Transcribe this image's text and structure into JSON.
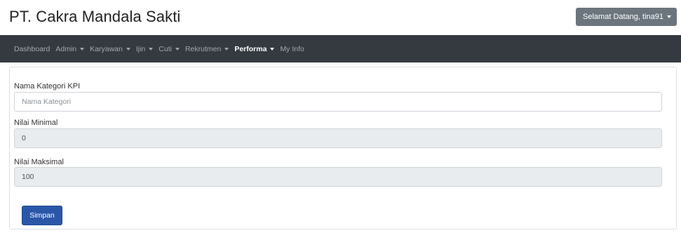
{
  "header": {
    "brand": "PT. Cakra Mandala Sakti",
    "user_menu_label": "Selamat Datang, tina91"
  },
  "nav": {
    "items": [
      {
        "label": "Dashboard",
        "dropdown": false,
        "active": false
      },
      {
        "label": "Admin",
        "dropdown": true,
        "active": false
      },
      {
        "label": "Karyawan",
        "dropdown": true,
        "active": false
      },
      {
        "label": "Ijin",
        "dropdown": true,
        "active": false
      },
      {
        "label": "Cuti",
        "dropdown": true,
        "active": false
      },
      {
        "label": "Rekrutmen",
        "dropdown": true,
        "active": false
      },
      {
        "label": "Performa",
        "dropdown": true,
        "active": true
      },
      {
        "label": "My Info",
        "dropdown": false,
        "active": false
      }
    ]
  },
  "form": {
    "kategori": {
      "label": "Nama Kategori KPI",
      "placeholder": "Nama Kategori",
      "value": ""
    },
    "minimal": {
      "label": "Nilai Minimal",
      "value": "0"
    },
    "maksimal": {
      "label": "Nilai Maksimal",
      "value": "100"
    },
    "submit_label": "Simpan"
  },
  "colors": {
    "navbar_bg": "#343a40",
    "user_button_bg": "#6c757d",
    "primary_button_bg": "#2a57a8",
    "readonly_input_bg": "#e9ecef"
  },
  "icons": {
    "dropdown": "caret-down-icon"
  }
}
